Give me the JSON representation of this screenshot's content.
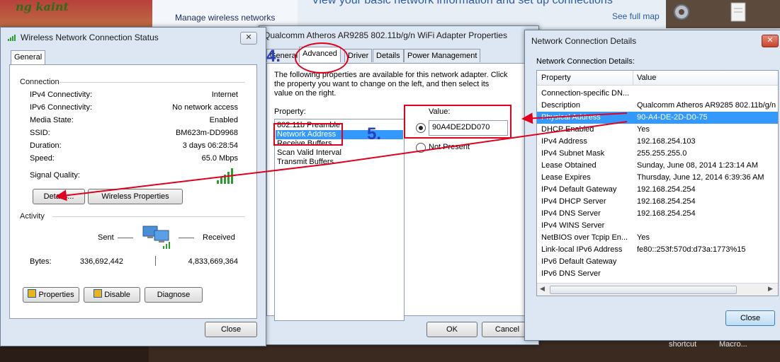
{
  "background": {
    "brand_text": "ng kaint",
    "manage_wireless": "Manage wireless networks",
    "view_basic": "View your basic network information and set up connections",
    "see_full_map": "See full map",
    "taskbar": [
      "shortcut",
      "Macro..."
    ]
  },
  "status_window": {
    "title": "Wireless Network Connection Status",
    "close_x": "✕",
    "tab": "General",
    "connection_title": "Connection",
    "rows": [
      {
        "label": "IPv4 Connectivity:",
        "value": "Internet"
      },
      {
        "label": "IPv6 Connectivity:",
        "value": "No network access"
      },
      {
        "label": "Media State:",
        "value": "Enabled"
      },
      {
        "label": "SSID:",
        "value": "BM623m-DD9968"
      },
      {
        "label": "Duration:",
        "value": "3 days 06:28:54"
      },
      {
        "label": "Speed:",
        "value": "65.0 Mbps"
      }
    ],
    "signal_label": "Signal Quality:",
    "details_btn": "Details...",
    "wireless_props_btn": "Wireless Properties",
    "activity_title": "Activity",
    "sent_label": "Sent",
    "received_label": "Received",
    "bytes_label": "Bytes:",
    "bytes_sent": "336,692,442",
    "bytes_received": "4,833,669,364",
    "properties_btn": "Properties",
    "disable_btn": "Disable",
    "diagnose_btn": "Diagnose",
    "close_btn": "Close"
  },
  "adapter_window": {
    "title": "Qualcomm Atheros AR9285 802.11b/g/n WiFi Adapter Properties",
    "tabs": [
      "General",
      "Advanced",
      "Driver",
      "Details",
      "Power Management"
    ],
    "description": "The following properties are available for this network adapter. Click the property you want to change on the left, and then select its value on the right.",
    "property_label": "Property:",
    "properties": [
      "802.11b Preamble",
      "Network Address",
      "Receive Buffers",
      "Scan Valid Interval",
      "Transmit Buffers"
    ],
    "selected_property": "Network Address",
    "value_label": "Value:",
    "value": "90A4DE2DD070",
    "not_present": "Not Present",
    "ok_btn": "OK",
    "cancel_btn": "Cancel",
    "step4": "4.",
    "step5": "5."
  },
  "details_window": {
    "title": "Network Connection Details",
    "close_x": "✕",
    "heading": "Network Connection Details:",
    "col_property": "Property",
    "col_value": "Value",
    "rows": [
      {
        "p": "Connection-specific DN...",
        "v": ""
      },
      {
        "p": "Description",
        "v": "Qualcomm Atheros AR9285 802.11b/g/n"
      },
      {
        "p": "Physical Address",
        "v": "90-A4-DE-2D-D0-75"
      },
      {
        "p": "DHCP Enabled",
        "v": "Yes"
      },
      {
        "p": "IPv4 Address",
        "v": "192.168.254.103"
      },
      {
        "p": "IPv4 Subnet Mask",
        "v": "255.255.255.0"
      },
      {
        "p": "Lease Obtained",
        "v": "Sunday, June 08, 2014 1:23:14 AM"
      },
      {
        "p": "Lease Expires",
        "v": "Thursday, June 12, 2014 6:39:36 AM"
      },
      {
        "p": "IPv4 Default Gateway",
        "v": "192.168.254.254"
      },
      {
        "p": "IPv4 DHCP Server",
        "v": "192.168.254.254"
      },
      {
        "p": "IPv4 DNS Server",
        "v": "192.168.254.254"
      },
      {
        "p": "IPv4 WINS Server",
        "v": ""
      },
      {
        "p": "NetBIOS over Tcpip En...",
        "v": "Yes"
      },
      {
        "p": "Link-local IPv6 Address",
        "v": "fe80::253f:570d:d73a:1773%15"
      },
      {
        "p": "IPv6 Default Gateway",
        "v": ""
      },
      {
        "p": "IPv6 DNS Server",
        "v": ""
      }
    ],
    "selected_index": 2,
    "close_btn": "Close"
  },
  "colors": {
    "selection": "#3399ff",
    "annotation_red": "#e00020",
    "annotation_blue": "#2a3fbf"
  }
}
